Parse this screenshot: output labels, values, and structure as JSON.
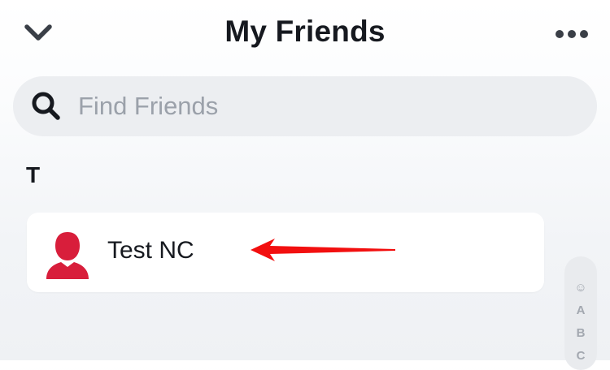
{
  "header": {
    "title": "My Friends",
    "back_icon": "chevron-down-icon",
    "more_icon": "ellipsis-icon"
  },
  "search": {
    "placeholder": "Find Friends",
    "value": "",
    "icon": "search-icon"
  },
  "sections": [
    {
      "letter": "T",
      "friends": [
        {
          "name": "Test NC",
          "avatar_color": "#d81e3b"
        }
      ]
    }
  ],
  "annotation": {
    "icon": "red-arrow-icon",
    "color": "#f20f0f"
  },
  "index_rail": {
    "items": [
      "☺",
      "A",
      "B",
      "C"
    ]
  },
  "colors": {
    "text_primary": "#16191f",
    "placeholder": "#9ba1aa",
    "search_bg": "#eceef1",
    "card_bg": "#ffffff",
    "index_text": "#a3a8b0"
  }
}
